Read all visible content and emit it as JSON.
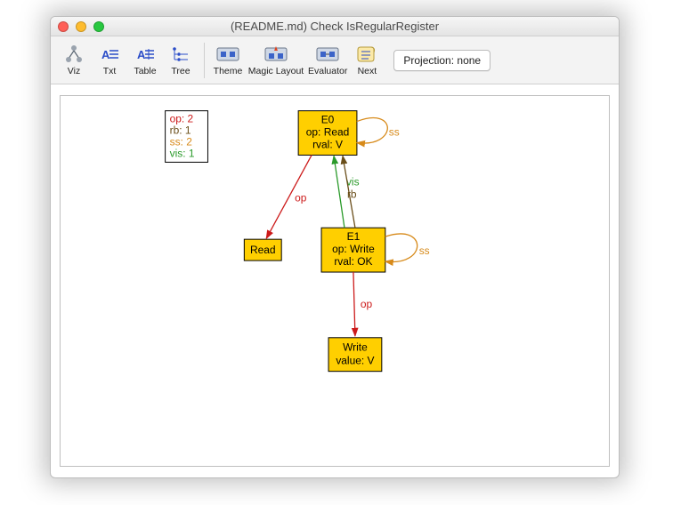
{
  "window": {
    "title": "(README.md) Check IsRegularRegister"
  },
  "toolbar": {
    "items": [
      {
        "id": "viz",
        "label": "Viz"
      },
      {
        "id": "txt",
        "label": "Txt"
      },
      {
        "id": "table",
        "label": "Table"
      },
      {
        "id": "tree",
        "label": "Tree"
      },
      {
        "id": "theme",
        "label": "Theme"
      },
      {
        "id": "magic",
        "label": "Magic Layout"
      },
      {
        "id": "eval",
        "label": "Evaluator"
      },
      {
        "id": "next",
        "label": "Next"
      }
    ],
    "projection": "Projection: none"
  },
  "legend": [
    {
      "label": "op: 2",
      "color": "#cc1a1a"
    },
    {
      "label": "rb: 1",
      "color": "#6a4e1a"
    },
    {
      "label": "ss: 2",
      "color": "#d78a1a"
    },
    {
      "label": "vis: 1",
      "color": "#2a9a2a"
    }
  ],
  "nodes": {
    "e0": {
      "lines": [
        "E0",
        "op: Read",
        "rval: V"
      ]
    },
    "e1": {
      "lines": [
        "E1",
        "op: Write",
        "rval: OK"
      ]
    },
    "read": {
      "lines": [
        "Read"
      ]
    },
    "write": {
      "lines": [
        "Write",
        "value: V"
      ]
    }
  },
  "edges": {
    "e0_read_op": "op",
    "e1_write_op": "op",
    "e1_e0_vis": "vis",
    "e1_e0_rb": "rb",
    "e0_ss": "ss",
    "e1_ss": "ss"
  },
  "chart_data": {
    "type": "graph",
    "title": "(README.md) Check IsRegularRegister",
    "nodes": [
      {
        "id": "E0",
        "attrs": {
          "op": "Read",
          "rval": "V"
        }
      },
      {
        "id": "E1",
        "attrs": {
          "op": "Write",
          "rval": "OK"
        }
      },
      {
        "id": "Read",
        "attrs": {}
      },
      {
        "id": "Write",
        "attrs": {
          "value": "V"
        }
      }
    ],
    "edges": [
      {
        "from": "E0",
        "to": "Read",
        "label": "op",
        "color": "#cc1a1a"
      },
      {
        "from": "E1",
        "to": "Write",
        "label": "op",
        "color": "#cc1a1a"
      },
      {
        "from": "E1",
        "to": "E0",
        "label": "vis",
        "color": "#2a9a2a"
      },
      {
        "from": "E1",
        "to": "E0",
        "label": "rb",
        "color": "#6a4e1a"
      },
      {
        "from": "E0",
        "to": "E0",
        "label": "ss",
        "color": "#d78a1a"
      },
      {
        "from": "E1",
        "to": "E1",
        "label": "ss",
        "color": "#d78a1a"
      }
    ],
    "relation_counts": {
      "op": 2,
      "rb": 1,
      "ss": 2,
      "vis": 1
    }
  }
}
